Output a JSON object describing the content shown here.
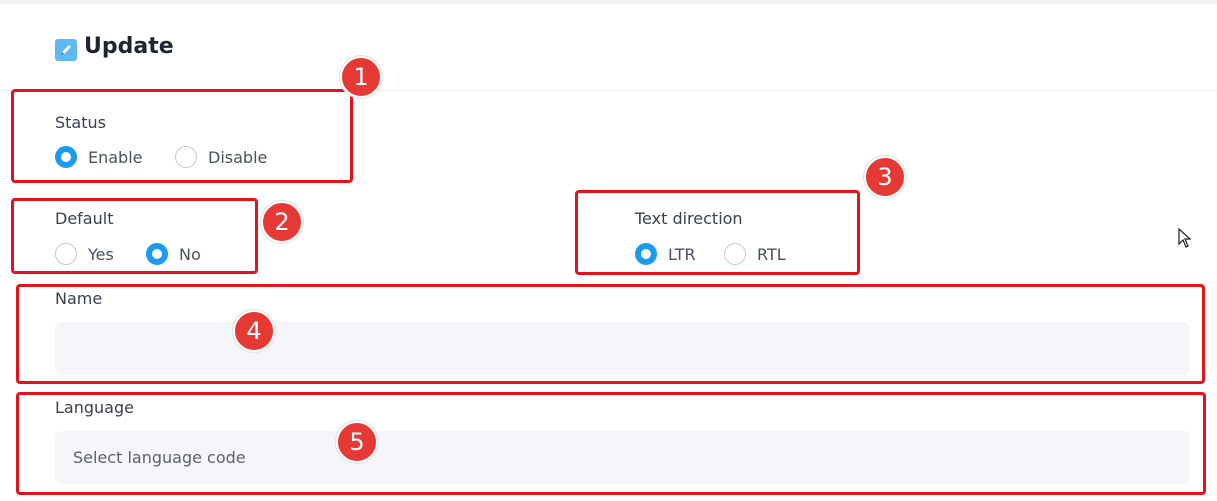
{
  "header": {
    "title": "Update",
    "icon": "edit-icon"
  },
  "status": {
    "label": "Status",
    "options": [
      {
        "label": "Enable",
        "selected": true
      },
      {
        "label": "Disable",
        "selected": false
      }
    ]
  },
  "default": {
    "label": "Default",
    "options": [
      {
        "label": "Yes",
        "selected": false
      },
      {
        "label": "No",
        "selected": true
      }
    ]
  },
  "text_direction": {
    "label": "Text direction",
    "options": [
      {
        "label": "LTR",
        "selected": true
      },
      {
        "label": "RTL",
        "selected": false
      }
    ]
  },
  "name": {
    "label": "Name",
    "value": "",
    "placeholder": ""
  },
  "language": {
    "label": "Language",
    "value": "",
    "placeholder": "Select language code"
  },
  "annotations": [
    "1",
    "2",
    "3",
    "4",
    "5"
  ],
  "colors": {
    "accent": "#1b9bf0",
    "annotation": "#e3121b",
    "input_bg": "#f4f6f9"
  }
}
